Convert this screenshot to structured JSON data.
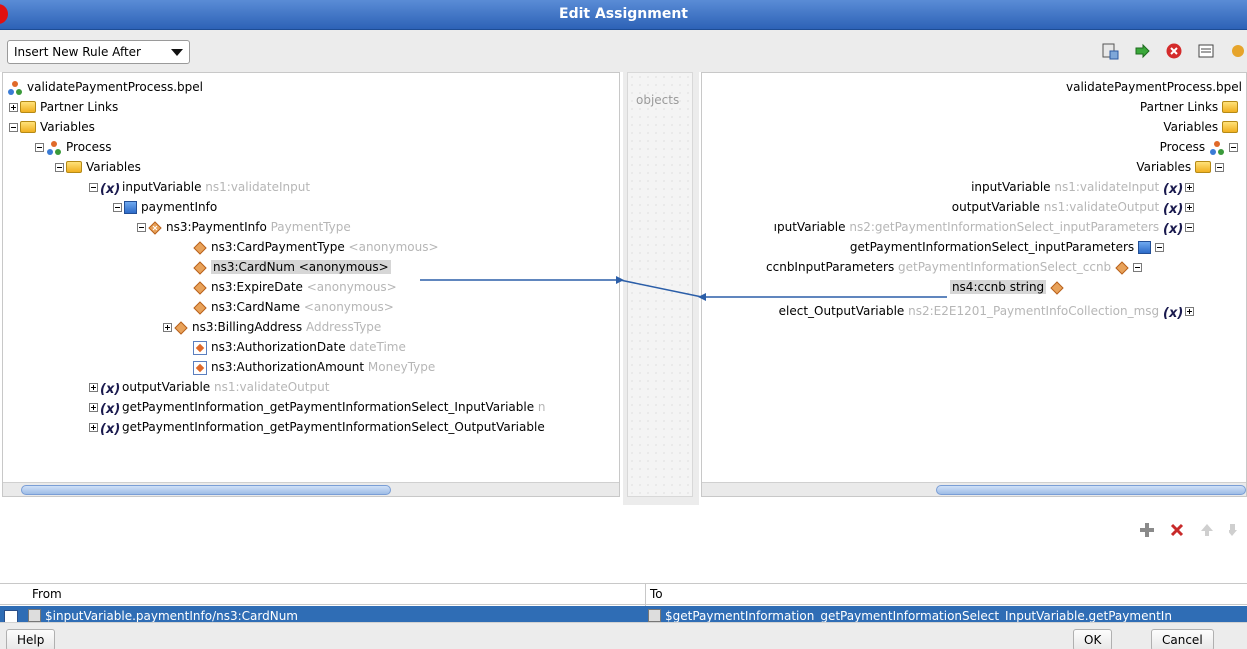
{
  "window": {
    "title": "Edit Assignment"
  },
  "toolbar": {
    "insert_dropdown_value": "Insert New Rule After"
  },
  "middle": {
    "label": "objects"
  },
  "left_tree": [
    {
      "id": "root",
      "label": "validatePaymentProcess.bpel",
      "type": ""
    },
    {
      "id": "partnerlinks",
      "label": "Partner Links",
      "type": ""
    },
    {
      "id": "variables",
      "label": "Variables",
      "type": ""
    },
    {
      "id": "process",
      "label": "Process",
      "type": ""
    },
    {
      "id": "variables2",
      "label": "Variables",
      "type": ""
    },
    {
      "id": "inputvariable",
      "label": "inputVariable",
      "type": "ns1:validateInput"
    },
    {
      "id": "paymentinfo",
      "label": "paymentInfo",
      "type": ""
    },
    {
      "id": "ns3paymentinfo",
      "label": "ns3:PaymentInfo",
      "type": "PaymentType"
    },
    {
      "id": "cardpaymenttype",
      "label": "ns3:CardPaymentType",
      "type": "<anonymous>"
    },
    {
      "id": "cardnum",
      "label": "ns3:CardNum <anonymous>",
      "type": ""
    },
    {
      "id": "expiredate",
      "label": "ns3:ExpireDate",
      "type": "<anonymous>"
    },
    {
      "id": "cardname",
      "label": "ns3:CardName",
      "type": "<anonymous>"
    },
    {
      "id": "billingaddress",
      "label": "ns3:BillingAddress",
      "type": "AddressType"
    },
    {
      "id": "authdate",
      "label": "ns3:AuthorizationDate",
      "type": "dateTime"
    },
    {
      "id": "authamount",
      "label": "ns3:AuthorizationAmount",
      "type": "MoneyType"
    },
    {
      "id": "outputvariable",
      "label": "outputVariable",
      "type": "ns1:validateOutput"
    },
    {
      "id": "getinputvar",
      "label": "getPaymentInformation_getPaymentInformationSelect_InputVariable",
      "type": "n"
    },
    {
      "id": "getoutputvar",
      "label": "getPaymentInformation_getPaymentInformationSelect_OutputVariable",
      "type": ""
    }
  ],
  "right_tree": [
    {
      "id": "root",
      "label": "validatePaymentProcess.bpel",
      "type": ""
    },
    {
      "id": "partnerlinks",
      "label": "Partner Links",
      "type": ""
    },
    {
      "id": "variables",
      "label": "Variables",
      "type": ""
    },
    {
      "id": "process",
      "label": "Process",
      "type": ""
    },
    {
      "id": "variables2",
      "label": "Variables",
      "type": ""
    },
    {
      "id": "inputvariable",
      "label": "inputVariable",
      "type": "ns1:validateInput"
    },
    {
      "id": "outputvariable",
      "label": "outputVariable",
      "type": "ns1:validateOutput"
    },
    {
      "id": "putvariable",
      "label": "ıputVariable",
      "type": "ns2:getPaymentInformationSelect_inputParameters"
    },
    {
      "id": "inputparams",
      "label": "getPaymentInformationSelect_inputParameters",
      "type": ""
    },
    {
      "id": "ccnbinputparams",
      "label": "ccnbInputParameters",
      "type": "getPaymentInformationSelect_ccnb"
    },
    {
      "id": "ns4ccnb",
      "label": "ns4:ccnb string",
      "type": ""
    },
    {
      "id": "selectoutput",
      "label": "elect_OutputVariable",
      "type": "ns2:E2E1201_PaymentInfoCollection_msg"
    }
  ],
  "table": {
    "headers": {
      "from": "From",
      "to": "To"
    },
    "rows": [
      {
        "from": "$inputVariable.paymentInfo/ns3:CardNum",
        "to": "$getPaymentInformation_getPaymentInformationSelect_InputVariable.getPaymentIn"
      }
    ]
  },
  "footer": {
    "help": "Help",
    "ok": "OK",
    "cancel": "Cancel"
  },
  "colors": {
    "title_bar": "#3b73c8",
    "selection": "#2f6db5",
    "map_line": "#2b5ea8"
  }
}
